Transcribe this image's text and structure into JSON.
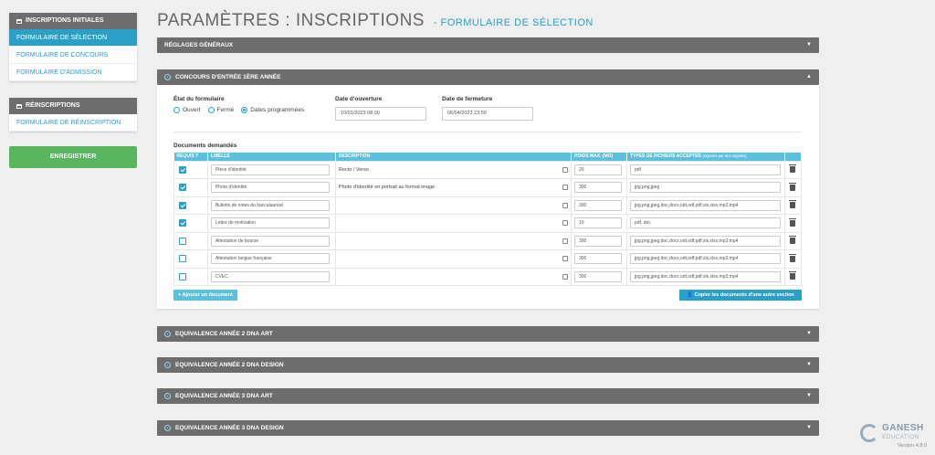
{
  "sidebar": {
    "group1": {
      "header": "INSCRIPTIONS INITIALES",
      "items": [
        {
          "label": "FORMULAIRE DE SÉLECTION",
          "active": true
        },
        {
          "label": "FORMULAIRE DE CONCOURS",
          "active": false
        },
        {
          "label": "FORMULAIRE D'ADMISSION",
          "active": false
        }
      ]
    },
    "group2": {
      "header": "RÉINSCRIPTIONS",
      "items": [
        {
          "label": "FORMULAIRE DE RÉINSCRIPTION",
          "active": false
        }
      ]
    },
    "save_label": "ENREGISTRER"
  },
  "page": {
    "title": "PARAMÈTRES : INSCRIPTIONS",
    "subtitle": "- FORMULAIRE DE SÉLECTION"
  },
  "sections": {
    "general": "RÉGLAGES GÉNÉRAUX",
    "open": "CONCOURS D'ENTRÉE 1ÈRE ANNÉE",
    "collapsed": [
      "EQUIVALENCE ANNÉE 2 DNA ART",
      "EQUIVALENCE ANNÉE 2 DNA DESIGN",
      "EQUIVALENCE ANNÉE 3 DNA ART",
      "EQUIVALENCE ANNÉE 3 DNA DESIGN"
    ]
  },
  "form": {
    "state_label": "État du formulaire",
    "options": [
      "Ouvert",
      "Fermé",
      "Dates programmées"
    ],
    "selected_option": 2,
    "open_date_label": "Date d'ouverture",
    "open_date": "10/01/2023 08:00",
    "close_date_label": "Date de fermeture",
    "close_date": "06/04/2023 23:59",
    "docs_label": "Documents demandés",
    "columns": [
      "REQUIS ?",
      "LIBELLÉ",
      "DESCRIPTION",
      "POIDS MAX. (MO)",
      "TYPES DE FICHIERS ACCEPTÉS",
      "(séparés par des virgules)"
    ],
    "rows": [
      {
        "required": true,
        "label": "Pièce d'identité",
        "description": "Recto / Verso",
        "weight": "20",
        "types": "pdf"
      },
      {
        "required": true,
        "label": "Photo d'identité",
        "description": "Photo d'identité en portrait au format image",
        "weight": "300",
        "types": "jpg,png,jpeg"
      },
      {
        "required": true,
        "label": "Bulletin de notes du baccalauréat",
        "description": "",
        "weight": "300",
        "types": "jpg,png,jpeg,doc,docx,odt,odf,pdf,xls,xlsx,mp3,mp4"
      },
      {
        "required": true,
        "label": "Lettre de motivation",
        "description": "",
        "weight": "10",
        "types": "pdf, doc"
      },
      {
        "required": false,
        "label": "Attestation de bourse",
        "description": "",
        "weight": "300",
        "types": "jpg,png,jpeg,doc,docx,odt,odf,pdf,xls,xlsx,mp3,mp4"
      },
      {
        "required": false,
        "label": "Attestation langue française",
        "description": "",
        "weight": "300",
        "types": "jpg,png,jpeg,doc,docx,odt,odf,pdf,xls,xlsx,mp3,mp4"
      },
      {
        "required": false,
        "label": "CVEC",
        "description": "",
        "weight": "300",
        "types": "jpg,png,jpeg,doc,docx,odt,odf,pdf,xls,xlsx,mp3,mp4"
      }
    ],
    "add_doc_label": "+ Ajouter un document",
    "copy_docs_label": "Copier les documents d'une autre section"
  },
  "branding": {
    "name": "GANESH",
    "tagline": "EDUCATION",
    "version": "Version 4.8.0"
  },
  "colors": {
    "accent": "#2a9fc8",
    "header_bar": "#6d6d6d",
    "table_head": "#5bc0de",
    "save": "#58b65d"
  }
}
